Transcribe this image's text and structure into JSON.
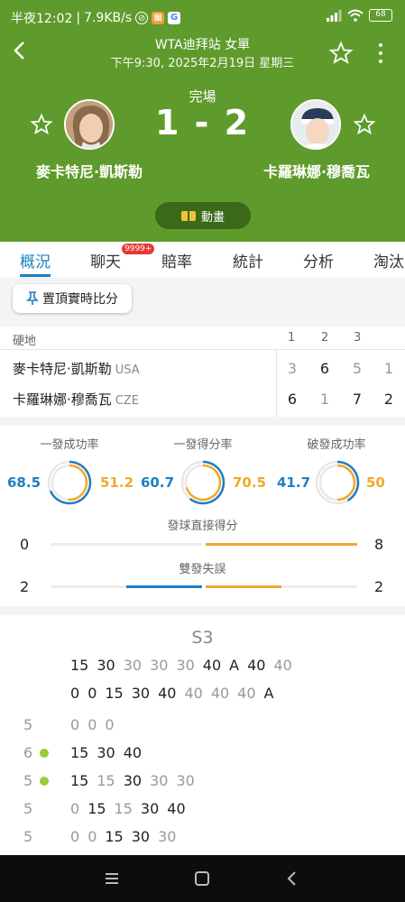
{
  "status_bar": {
    "time": "半夜12:02",
    "speed": "7.9KB/s",
    "battery": "68"
  },
  "header": {
    "tournament": "WTA迪拜站 女單",
    "datetime": "下午9:30, 2025年2月19日 星期三",
    "match_status": "完場",
    "score": "1 - 2",
    "player1": "麥卡特尼·凱斯勒",
    "player2": "卡羅琳娜·穆喬瓦",
    "animation_label": "動畫"
  },
  "tabs": [
    "概況",
    "聊天",
    "賠率",
    "統計",
    "分析",
    "淘汰"
  ],
  "chat_badge": "9999+",
  "pin_button": "置頂實時比分",
  "set_table": {
    "surface": "硬地",
    "headers": [
      "1",
      "2",
      "3"
    ],
    "rows": [
      {
        "name": "麥卡特尼·凱斯勒",
        "country": "USA",
        "sets": [
          "3",
          "6",
          "5"
        ],
        "extra": "1"
      },
      {
        "name": "卡羅琳娜·穆喬瓦",
        "country": "CZE",
        "sets": [
          "6",
          "1",
          "7"
        ],
        "extra": "2"
      }
    ]
  },
  "stats": {
    "circles": [
      {
        "title": "一發成功率",
        "left": "68.5",
        "right": "51.2",
        "left_frac": 0.685,
        "right_frac": 0.512
      },
      {
        "title": "一發得分率",
        "left": "60.7",
        "right": "70.5",
        "left_frac": 0.607,
        "right_frac": 0.705
      },
      {
        "title": "破發成功率",
        "left": "41.7",
        "right": "50",
        "left_frac": 0.417,
        "right_frac": 0.5
      }
    ],
    "bars": [
      {
        "title": "發球直接得分",
        "left": "0",
        "right": "8"
      },
      {
        "title": "雙發失誤",
        "left": "2",
        "right": "2"
      }
    ]
  },
  "pbp": {
    "set_label": "S3",
    "top_rows": [
      [
        "15",
        "30",
        "30",
        "30",
        "30",
        "40",
        "A",
        "40",
        "40"
      ],
      [
        "0",
        "0",
        "15",
        "30",
        "40",
        "40",
        "40",
        "40",
        "A"
      ]
    ],
    "games": [
      {
        "score": "5",
        "points": [
          "0",
          "0",
          "0"
        ],
        "ball": false
      },
      {
        "score": "6",
        "points": [
          "15",
          "30",
          "40"
        ],
        "ball": true
      },
      {
        "score": "5",
        "points": [
          "15",
          "15",
          "30",
          "30",
          "30"
        ],
        "ball": true
      },
      {
        "score": "5",
        "points": [
          "0",
          "15",
          "15",
          "30",
          "40"
        ],
        "ball": false
      },
      {
        "score": "5",
        "points": [
          "0",
          "0",
          "15",
          "30",
          "30"
        ],
        "ball": false
      }
    ]
  },
  "colors": {
    "header_green": "#5f9b2c",
    "blue": "#1f7fc4",
    "orange": "#f0a92a"
  }
}
